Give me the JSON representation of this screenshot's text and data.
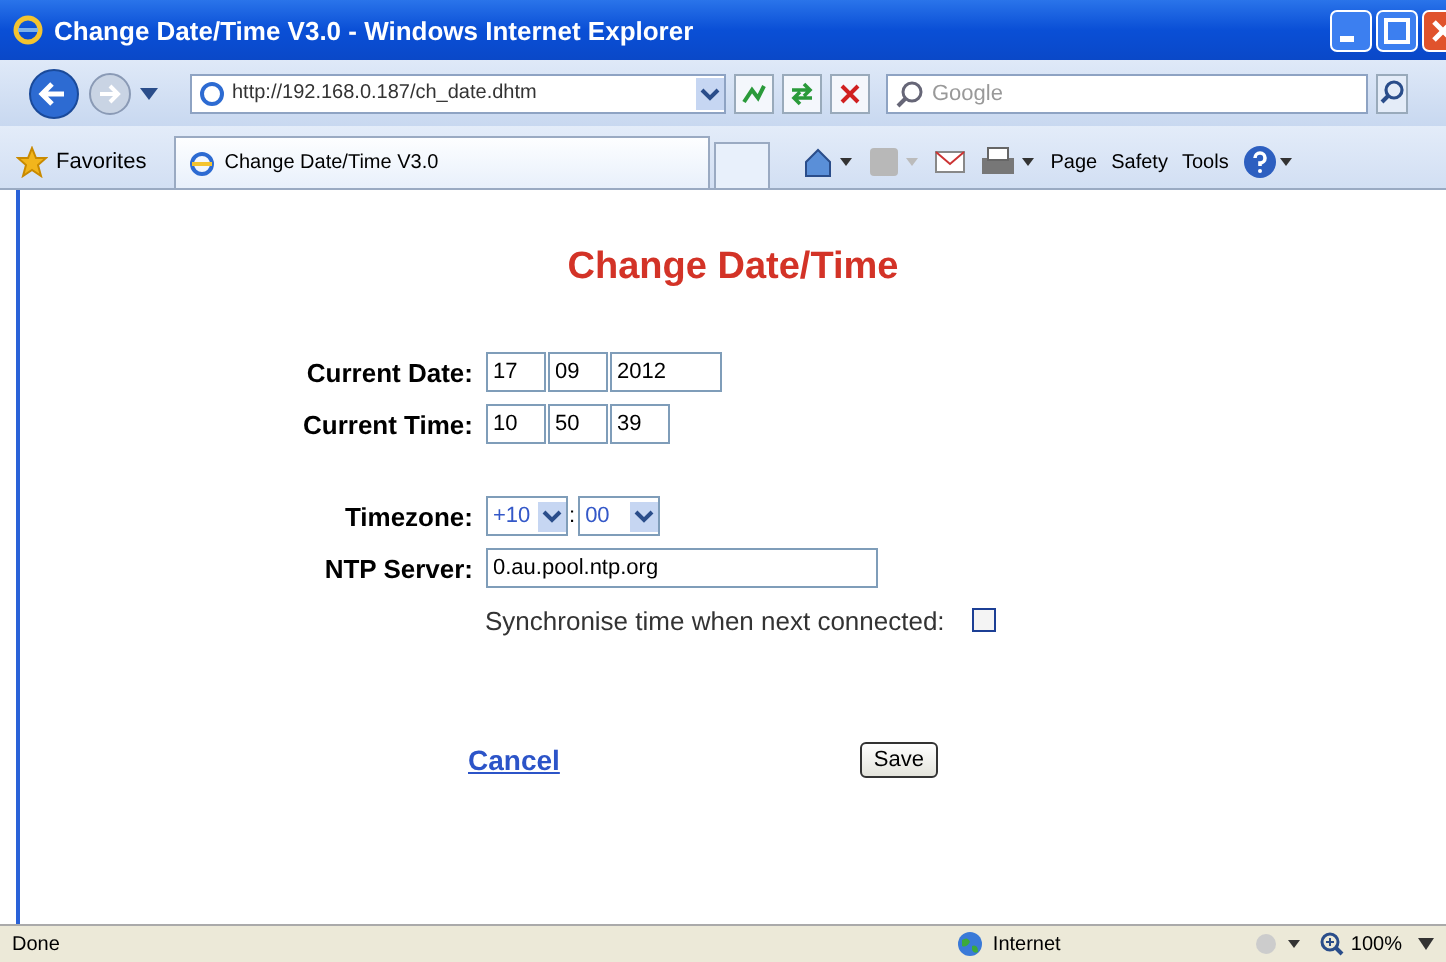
{
  "window": {
    "title": "Change Date/Time V3.0 - Windows Internet Explorer"
  },
  "address_bar": {
    "url": "http://192.168.0.187/ch_date.dhtm"
  },
  "search": {
    "placeholder": "Google"
  },
  "favorites": {
    "label": "Favorites"
  },
  "tabs": [
    {
      "label": "Change Date/Time V3.0",
      "selected": true
    }
  ],
  "command_bar": [
    {
      "label": "Page"
    },
    {
      "label": "Safety"
    },
    {
      "label": "Tools"
    }
  ],
  "page": {
    "heading": "Change Date/Time",
    "date": {
      "label": "Current Date:",
      "fields": [
        "17",
        "09",
        "2012"
      ]
    },
    "time": {
      "label": "Current Time:",
      "fields": [
        "10",
        "50",
        "39"
      ]
    },
    "timezone": {
      "label": "Timezone:",
      "hours": "+10",
      "separator": ":",
      "minutes": "00"
    },
    "ntp": {
      "label": "NTP Server:",
      "value": "0.au.pool.ntp.org"
    },
    "sync": {
      "label": "Synchronise time when next connected:",
      "checked": false
    },
    "cancel": "Cancel",
    "save": "Save"
  },
  "status_bar": {
    "status": "Done",
    "zone": "Internet",
    "zoom": "100%"
  }
}
